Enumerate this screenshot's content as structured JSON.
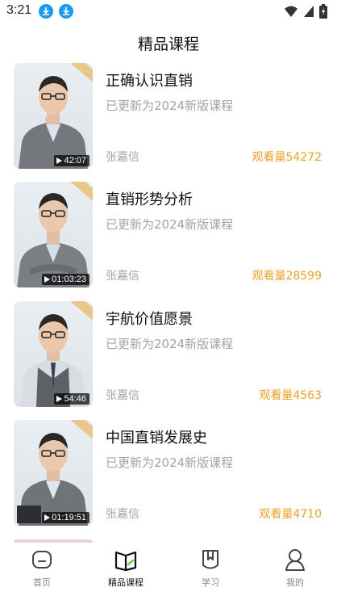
{
  "status_bar": {
    "time": "3:21"
  },
  "header": {
    "title": "精品课程"
  },
  "courses": [
    {
      "title": "正确认识直销",
      "subtitle": "已更新为2024新版课程",
      "author": "张嘉信",
      "views": "观看量54272",
      "duration": "42:07"
    },
    {
      "title": "直销形势分析",
      "subtitle": "已更新为2024新版课程",
      "author": "张嘉信",
      "views": "观看量28599",
      "duration": "01:03:23"
    },
    {
      "title": "宇航价值愿景",
      "subtitle": "已更新为2024新版课程",
      "author": "张嘉信",
      "views": "观看量4563",
      "duration": "54:46"
    },
    {
      "title": "中国直销发展史",
      "subtitle": "已更新为2024新版课程",
      "author": "张嘉信",
      "views": "观看量4710",
      "duration": "01:19:51"
    }
  ],
  "bottom_nav": {
    "items": [
      {
        "label": "首页",
        "icon": "home-icon"
      },
      {
        "label": "精品课程",
        "icon": "book-icon"
      },
      {
        "label": "学习",
        "icon": "bookmark-icon"
      },
      {
        "label": "我的",
        "icon": "profile-icon"
      }
    ],
    "active_index": 1
  },
  "colors": {
    "accent_views": "#eaa22a",
    "download_badge": "#1a9bf0"
  }
}
